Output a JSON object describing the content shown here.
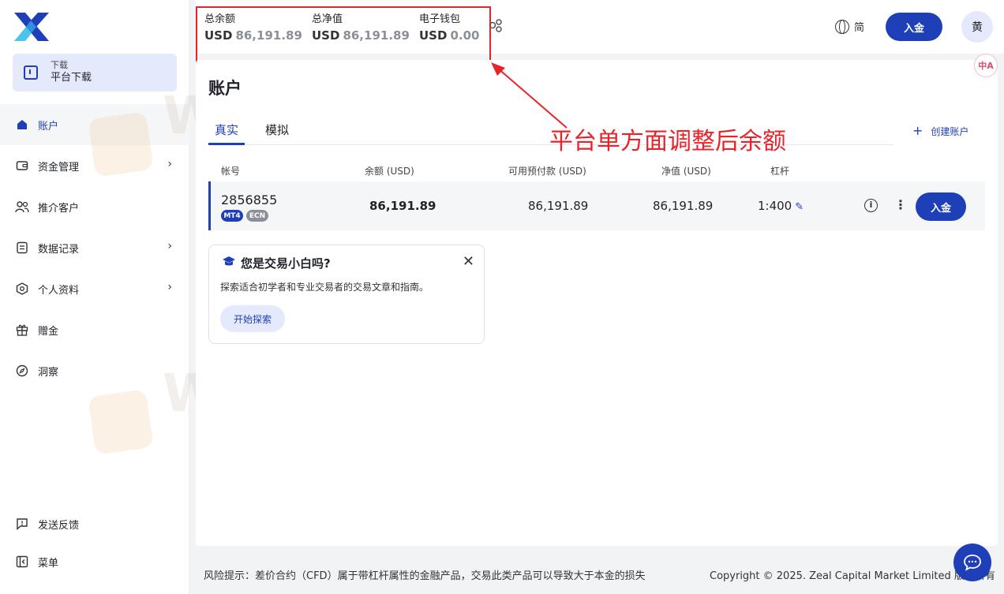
{
  "sidebar": {
    "download": {
      "small": "下载",
      "big": "平台下载"
    },
    "items": [
      {
        "label": "账户",
        "icon": "home-icon",
        "active": true
      },
      {
        "label": "资金管理",
        "icon": "wallet-icon",
        "chevron": true
      },
      {
        "label": "推介客户",
        "icon": "users-icon"
      },
      {
        "label": "数据记录",
        "icon": "document-icon",
        "chevron": true
      },
      {
        "label": "个人资料",
        "icon": "profile-hexagon-icon",
        "chevron": true
      },
      {
        "label": "赠金",
        "icon": "gift-icon"
      },
      {
        "label": "洞察",
        "icon": "compass-icon"
      }
    ],
    "bottom_items": [
      {
        "label": "发送反馈",
        "icon": "feedback-icon"
      },
      {
        "label": "菜单",
        "icon": "menu-collapse-icon"
      }
    ]
  },
  "topbar": {
    "balances": [
      {
        "label": "总余额",
        "currency": "USD",
        "value": "86,191.89"
      },
      {
        "label": "总净值",
        "currency": "USD",
        "value": "86,191.89"
      },
      {
        "label": "电子钱包",
        "currency": "USD",
        "value": "0.00"
      }
    ],
    "lang_label": "简",
    "deposit_label": "入金",
    "avatar_text": "黄"
  },
  "main": {
    "title": "账户",
    "tabs": [
      "真实",
      "模拟"
    ],
    "create_account": "创建账户",
    "annotation": "平台单方面调整后余额",
    "table": {
      "headers": [
        "帐号",
        "余额 (USD)",
        "可用预付款 (USD)",
        "净值 (USD)",
        "杠杆"
      ],
      "row": {
        "account": "2856855",
        "badges": [
          "MT4",
          "ECN"
        ],
        "balance": "86,191.89",
        "free_margin": "86,191.89",
        "equity": "86,191.89",
        "leverage": "1:400",
        "deposit_label": "入金"
      }
    },
    "promo": {
      "title": "您是交易小白吗?",
      "desc": "探索适合初学者和专业交易者的交易文章和指南。",
      "button": "开始探索"
    }
  },
  "footer": {
    "risk": "风险提示：差价合约（CFD）属于带杠杆属性的金融产品，交易此类产品可以导致大于本金的损失",
    "copyright": "Copyright © 2025. Zeal Capital Market Limited 版权所有"
  },
  "watermark": "WikiFX",
  "colors": {
    "accent": "#1f3fb8",
    "annotation": "#e8242a",
    "active_bg": "#e4e9fb"
  }
}
